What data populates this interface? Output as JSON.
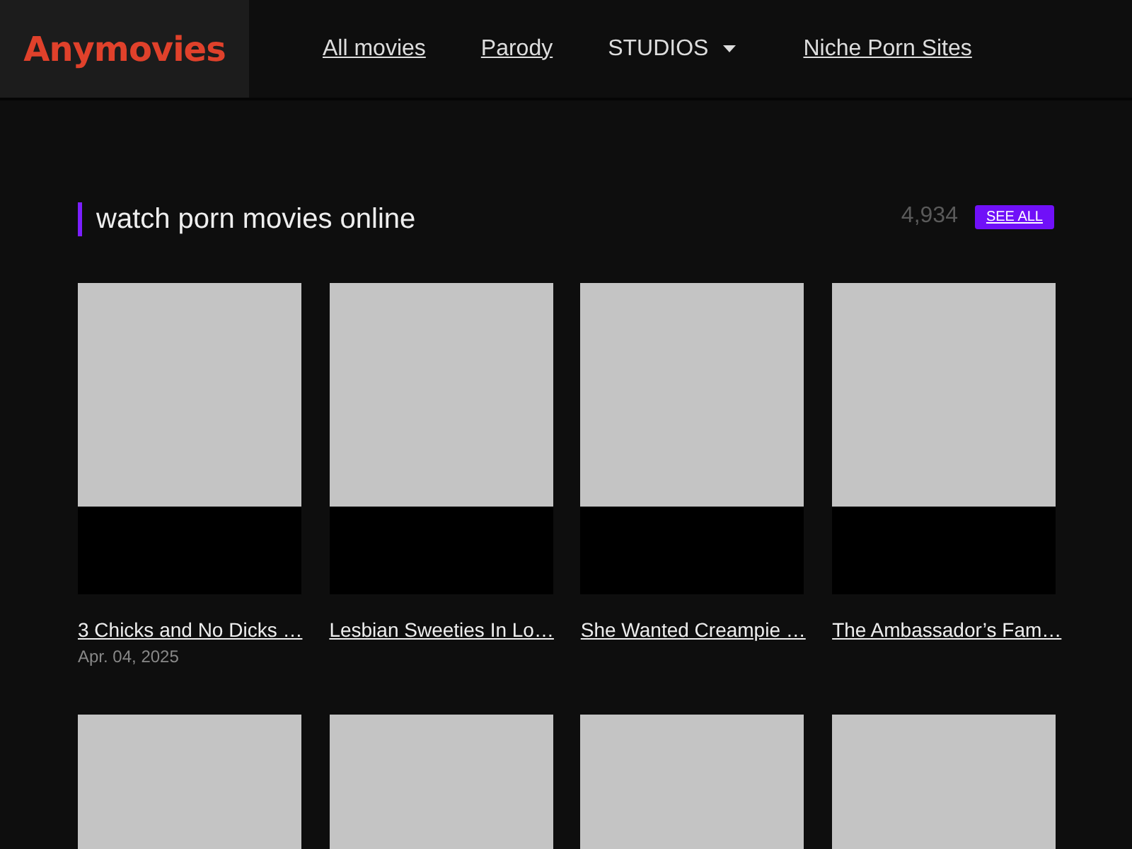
{
  "header": {
    "logo": "Anymovies",
    "nav": [
      {
        "label": "All movies",
        "kind": "link"
      },
      {
        "label": "Parody",
        "kind": "link"
      },
      {
        "label": "STUDIOS",
        "kind": "dropdown"
      },
      {
        "label": "Niche Porn Sites",
        "kind": "link"
      }
    ]
  },
  "section": {
    "title": "watch porn movies online",
    "count": "4,934",
    "see_all": "SEE ALL"
  },
  "movies": [
    {
      "kind": "loaded",
      "title": "3 Chicks and No Dicks …",
      "date": "Apr. 04, 2025"
    },
    {
      "kind": "loaded",
      "title": "Lesbian Sweeties In Lo…"
    },
    {
      "kind": "loaded",
      "title": "She Wanted Creampie …"
    },
    {
      "kind": "loaded",
      "title": "The Ambassador’s Fam…"
    },
    {
      "kind": "cut"
    },
    {
      "kind": "cut"
    },
    {
      "kind": "cut"
    },
    {
      "kind": "cut"
    }
  ]
}
